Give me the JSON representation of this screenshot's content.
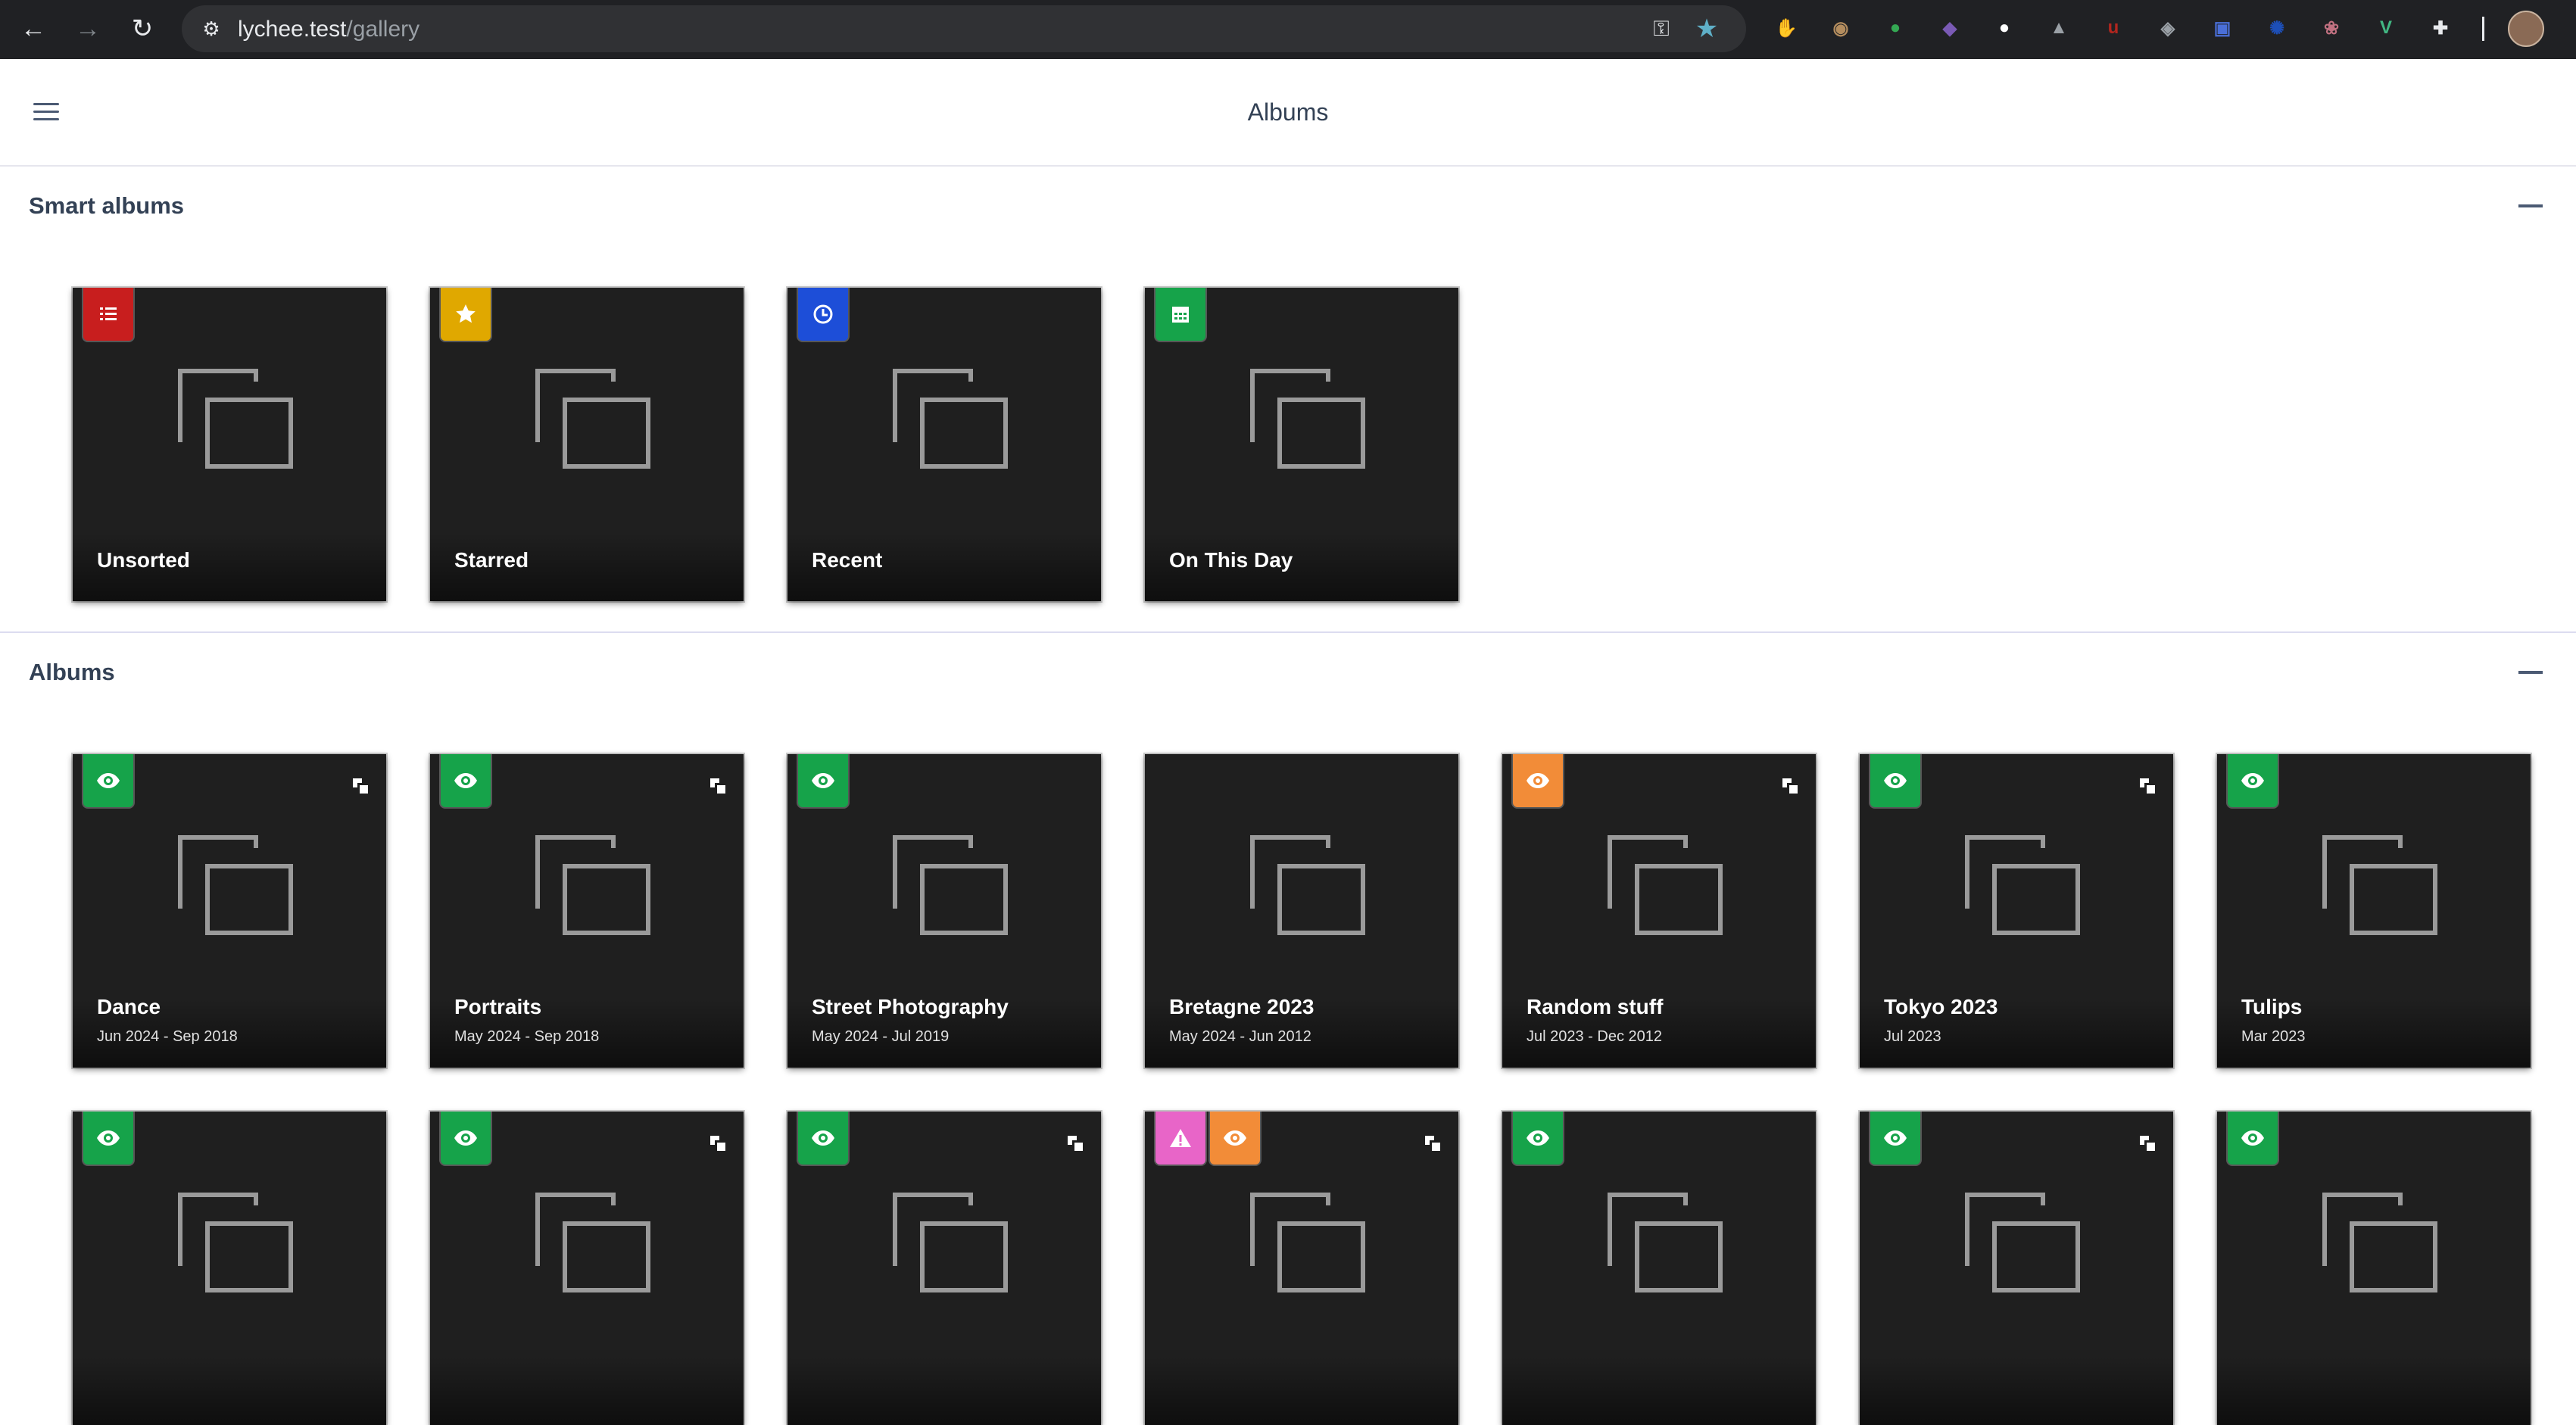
{
  "browser": {
    "url_host": "lychee.test",
    "url_path": "/gallery",
    "extensions": [
      {
        "name": "adblock-ext-icon",
        "color": "#d93025",
        "glyph": "✋"
      },
      {
        "name": "owl-ext-icon",
        "color": "#b48d5e",
        "glyph": "◉"
      },
      {
        "name": "green-ext-icon",
        "color": "#34a853",
        "glyph": "●"
      },
      {
        "name": "cat-ext-icon",
        "color": "#7a5ab5",
        "glyph": "◆"
      },
      {
        "name": "record-ext-icon",
        "color": "#ffffff",
        "glyph": "●"
      },
      {
        "name": "rocket-ext-icon",
        "color": "#9aa0a6",
        "glyph": "▲"
      },
      {
        "name": "ublock-ext-icon",
        "color": "#b3261e",
        "glyph": "u"
      },
      {
        "name": "shield-ext-icon",
        "color": "#9aa0a6",
        "glyph": "◈"
      },
      {
        "name": "screen-ext-icon",
        "color": "#4a6fd8",
        "glyph": "▣"
      },
      {
        "name": "gear-ext-icon",
        "color": "#1d4fb8",
        "glyph": "✺"
      },
      {
        "name": "brain-ext-icon",
        "color": "#c07080",
        "glyph": "❀"
      },
      {
        "name": "vue-ext-icon",
        "color": "#42b883",
        "glyph": "V"
      },
      {
        "name": "puzzle-ext-icon",
        "color": "#e8eaed",
        "glyph": "✚"
      }
    ]
  },
  "header": {
    "title": "Albums"
  },
  "smart_albums": {
    "title": "Smart albums",
    "items": [
      {
        "title": "Unsorted",
        "badge_color": "#c81e1e",
        "badge_icon": "list-icon"
      },
      {
        "title": "Starred",
        "badge_color": "#e0a800",
        "badge_icon": "star-icon"
      },
      {
        "title": "Recent",
        "badge_color": "#1d4ed8",
        "badge_icon": "clock-icon"
      },
      {
        "title": "On This Day",
        "badge_color": "#16a34a",
        "badge_icon": "calendar-icon"
      }
    ]
  },
  "albums": {
    "title": "Albums",
    "items": [
      {
        "title": "Dance",
        "dates": "Jun 2024 - Sep 2018",
        "badges": [
          {
            "color": "#16a34a",
            "icon": "eye-icon"
          }
        ],
        "has_sub": true
      },
      {
        "title": "Portraits",
        "dates": "May 2024 - Sep 2018",
        "badges": [
          {
            "color": "#16a34a",
            "icon": "eye-icon"
          }
        ],
        "has_sub": true
      },
      {
        "title": "Street Photography",
        "dates": "May 2024 - Jul 2019",
        "badges": [
          {
            "color": "#16a34a",
            "icon": "eye-icon"
          }
        ],
        "has_sub": false
      },
      {
        "title": "Bretagne 2023",
        "dates": "May 2024 - Jun 2012",
        "badges": [],
        "has_sub": false
      },
      {
        "title": "Random stuff",
        "dates": "Jul 2023 - Dec 2012",
        "badges": [
          {
            "color": "#f28c38",
            "icon": "eye-icon"
          }
        ],
        "has_sub": true
      },
      {
        "title": "Tokyo 2023",
        "dates": "Jul 2023",
        "badges": [
          {
            "color": "#16a34a",
            "icon": "eye-icon"
          }
        ],
        "has_sub": true
      },
      {
        "title": "Tulips",
        "dates": "Mar 2023",
        "badges": [
          {
            "color": "#16a34a",
            "icon": "eye-icon"
          }
        ],
        "has_sub": false
      }
    ],
    "row2": [
      {
        "badges": [
          {
            "color": "#16a34a",
            "icon": "eye-icon"
          }
        ],
        "has_sub": false
      },
      {
        "badges": [
          {
            "color": "#16a34a",
            "icon": "eye-icon"
          }
        ],
        "has_sub": true
      },
      {
        "badges": [
          {
            "color": "#16a34a",
            "icon": "eye-icon"
          }
        ],
        "has_sub": true
      },
      {
        "badges": [
          {
            "color": "#e865c8",
            "icon": "warning-icon"
          },
          {
            "color": "#f28c38",
            "icon": "eye-icon"
          }
        ],
        "has_sub": true
      },
      {
        "badges": [
          {
            "color": "#16a34a",
            "icon": "eye-icon"
          }
        ],
        "has_sub": false
      },
      {
        "badges": [
          {
            "color": "#16a34a",
            "icon": "eye-icon"
          }
        ],
        "has_sub": true
      },
      {
        "badges": [
          {
            "color": "#16a34a",
            "icon": "eye-icon"
          }
        ],
        "has_sub": false
      }
    ]
  }
}
